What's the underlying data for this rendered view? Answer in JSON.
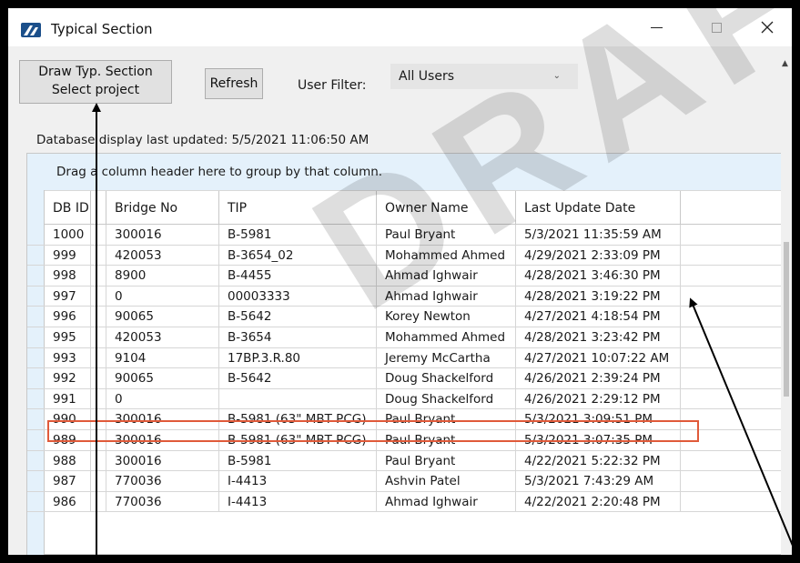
{
  "window": {
    "title": "Typical Section"
  },
  "toolbar": {
    "draw_line1": "Draw Typ. Section",
    "draw_line2": "Select project",
    "refresh_label": "Refresh",
    "filter_label": "User Filter:",
    "filter_value": "All Users"
  },
  "status": {
    "updated": "Database display last updated: 5/5/2021 11:06:50 AM"
  },
  "grid": {
    "group_hint": "Drag a column header here to group by that column.",
    "headers": {
      "id": "DB ID",
      "bridge": "Bridge No",
      "tip": "TIP",
      "owner": "Owner Name",
      "date": "Last Update Date"
    },
    "rows": [
      {
        "id": "1000",
        "bridge": "300016",
        "tip": "B-5981",
        "owner": "Paul Bryant",
        "date": "5/3/2021 11:35:59 AM"
      },
      {
        "id": "999",
        "bridge": "420053",
        "tip": "B-3654_02",
        "owner": "Mohammed Ahmed",
        "date": "4/29/2021 2:33:09 PM"
      },
      {
        "id": "998",
        "bridge": "8900",
        "tip": "B-4455",
        "owner": "Ahmad Ighwair",
        "date": "4/28/2021 3:46:30 PM"
      },
      {
        "id": "997",
        "bridge": "0",
        "tip": "00003333",
        "owner": "Ahmad Ighwair",
        "date": "4/28/2021 3:19:22 PM"
      },
      {
        "id": "996",
        "bridge": "90065",
        "tip": "B-5642",
        "owner": "Korey Newton",
        "date": "4/27/2021 4:18:54 PM"
      },
      {
        "id": "995",
        "bridge": "420053",
        "tip": "B-3654",
        "owner": "Mohammed Ahmed",
        "date": "4/28/2021 3:23:42 PM"
      },
      {
        "id": "993",
        "bridge": "9104",
        "tip": "17BP.3.R.80",
        "owner": "Jeremy McCartha",
        "date": "4/27/2021 10:07:22 AM"
      },
      {
        "id": "992",
        "bridge": "90065",
        "tip": "B-5642",
        "owner": "Doug Shackelford",
        "date": "4/26/2021 2:39:24 PM"
      },
      {
        "id": "991",
        "bridge": "0",
        "tip": "",
        "owner": "Doug Shackelford",
        "date": "4/26/2021 2:29:12 PM"
      },
      {
        "id": "990",
        "bridge": "300016",
        "tip": "B-5981 (63\" MBT PCG)",
        "owner": "Paul Bryant",
        "date": "5/3/2021 3:09:51 PM"
      },
      {
        "id": "989",
        "bridge": "300016",
        "tip": "B-5981 (63\" MBT PCG)",
        "owner": "Paul Bryant",
        "date": "5/3/2021 3:07:35 PM"
      },
      {
        "id": "988",
        "bridge": "300016",
        "tip": "B-5981",
        "owner": "Paul Bryant",
        "date": "4/22/2021 5:22:32 PM"
      },
      {
        "id": "987",
        "bridge": "770036",
        "tip": "I-4413",
        "owner": "Ashvin Patel",
        "date": "5/3/2021 7:43:29 AM"
      },
      {
        "id": "986",
        "bridge": "770036",
        "tip": "I-4413",
        "owner": "Ahmad Ighwair",
        "date": "4/22/2021 2:20:48 PM"
      }
    ]
  },
  "watermark": "DRAFT",
  "colors": {
    "highlight": "#e05a3a",
    "group_panel": "#e4f1fb",
    "app_icon": "#1b4f8a"
  }
}
